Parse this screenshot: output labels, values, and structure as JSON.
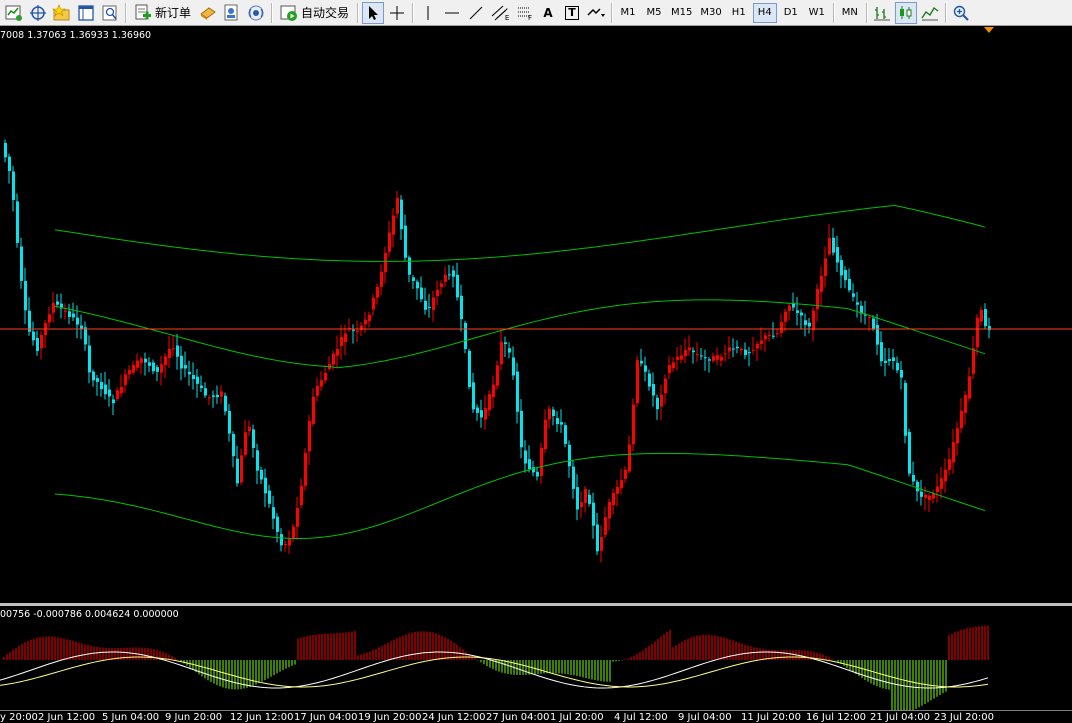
{
  "toolbar": {
    "new_order_label": "新订单",
    "auto_trading_label": "自动交易",
    "timeframes": [
      "M1",
      "M5",
      "M15",
      "M30",
      "H1",
      "H4",
      "D1",
      "W1",
      "MN"
    ],
    "active_timeframe": "H4",
    "letter_tools": [
      "A",
      "T"
    ],
    "fib_tool_sublabel": "F",
    "grid_tool_sublabel": "E"
  },
  "chart": {
    "price_info": "7008 1.37063 1.36933 1.36960",
    "osc_info": "00756 -0.000786 0.004624 0.000000",
    "time_labels": [
      "y 20:00",
      "2 Jun 12:00",
      "5 Jun 04:00",
      "9 Jun 20:00",
      "12 Jun 12:00",
      "17 Jun 04:00",
      "19 Jun 20:00",
      "24 Jun 12:00",
      "27 Jun 04:00",
      "1 Jul 20:00",
      "4 Jul 12:00",
      "9 Jul 04:00",
      "11 Jul 20:00",
      "16 Jul 12:00",
      "21 Jul 04:00",
      "23 Jul 20:00"
    ],
    "colors": {
      "background": "#000000",
      "bull_candle": "#ff0000",
      "bear_candle": "#00e5ee",
      "channel": "#00c000",
      "price_line": "#ff4020",
      "hist_up": "#ff0000",
      "hist_down": "#7cfc00",
      "signal_white": "#ffffff",
      "signal_yellow": "#ffff80"
    }
  }
}
